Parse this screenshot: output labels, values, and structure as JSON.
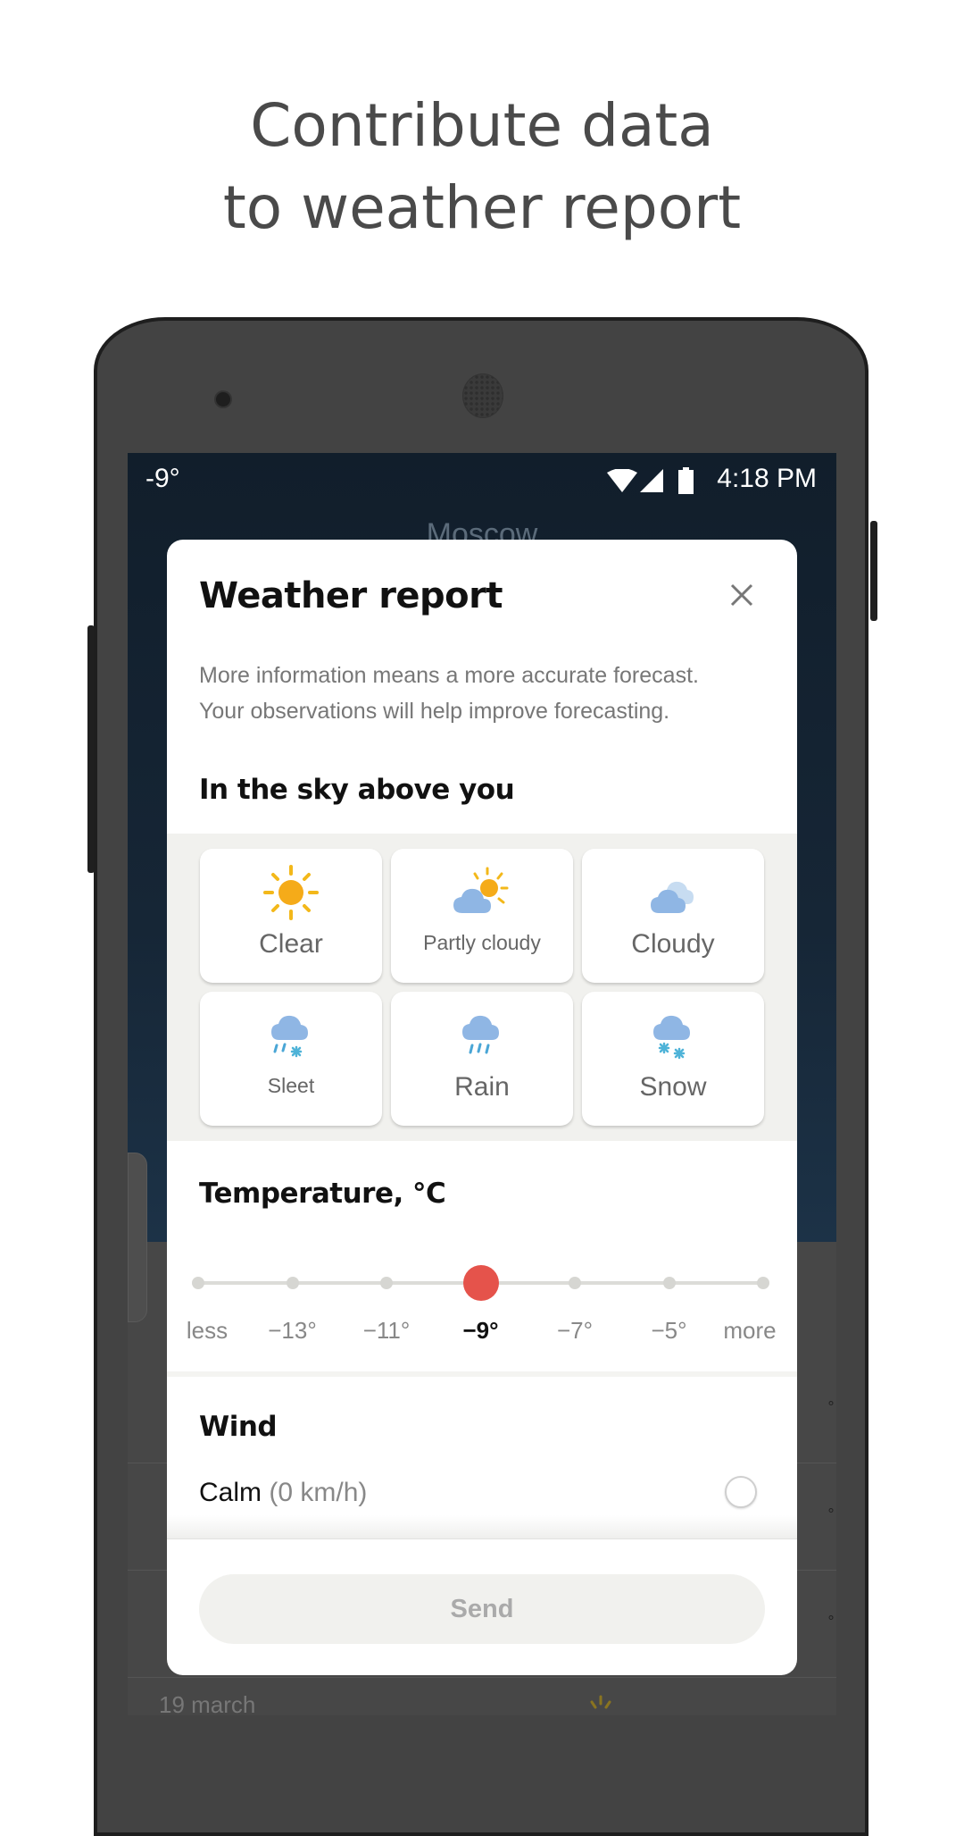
{
  "promo": {
    "headline_line1": "Contribute data",
    "headline_line2": "to weather report"
  },
  "status_bar": {
    "temperature": "-9°",
    "time": "4:18 PM",
    "icons": [
      "wifi-icon",
      "cellular-signal-icon",
      "battery-icon"
    ]
  },
  "background_app": {
    "city": "Moscow",
    "list_first_date": "19 march",
    "list_degree_symbol": "°"
  },
  "dialog": {
    "title": "Weather report",
    "close_icon": "close-icon",
    "description_line1": "More information means a more accurate forecast.",
    "description_line2": "Your observations will help improve forecasting.",
    "sky_section": {
      "title": "In the sky above you",
      "options": [
        {
          "label": "Clear",
          "icon": "sun-icon"
        },
        {
          "label": "Partly cloudy",
          "icon": "partly-cloudy-icon"
        },
        {
          "label": "Cloudy",
          "icon": "cloudy-icon"
        },
        {
          "label": "Sleet",
          "icon": "sleet-icon"
        },
        {
          "label": "Rain",
          "icon": "rain-icon"
        },
        {
          "label": "Snow",
          "icon": "snow-icon"
        }
      ]
    },
    "temperature_section": {
      "title": "Temperature, °C",
      "stops": [
        "less",
        "−13°",
        "−11°",
        "−9°",
        "−7°",
        "−5°",
        "more"
      ],
      "selected_index": 3,
      "selected_value": "−9°",
      "accent_color": "#e5534b"
    },
    "wind_section": {
      "title": "Wind",
      "option_label": "Calm",
      "option_detail": "(0 km/h)",
      "option_selected": false
    },
    "send_label": "Send"
  }
}
